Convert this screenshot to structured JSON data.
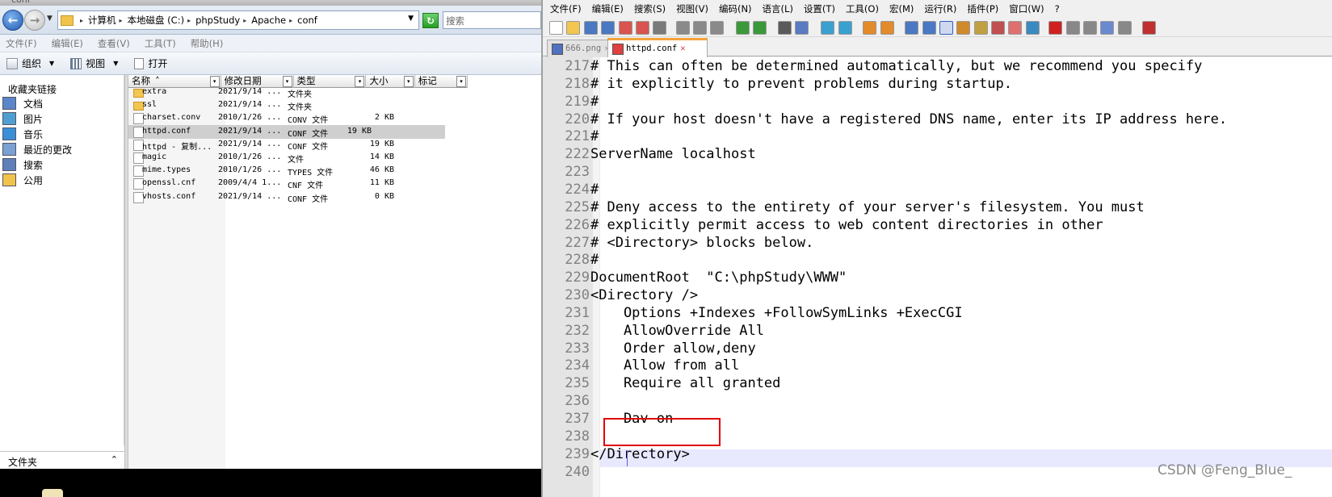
{
  "explorer": {
    "window_title": "conf",
    "address": {
      "crumbs": [
        "计算机",
        "本地磁盘 (C:)",
        "phpStudy",
        "Apache",
        "conf"
      ],
      "search_placeholder": "搜索"
    },
    "menu": [
      "文件(F)",
      "编辑(E)",
      "查看(V)",
      "工具(T)",
      "帮助(H)"
    ],
    "toolbar": {
      "organize": "组织",
      "view": "视图",
      "open": "打开"
    },
    "nav": {
      "header": "收藏夹链接",
      "items": [
        {
          "label": "文档",
          "icon": "documents-icon"
        },
        {
          "label": "图片",
          "icon": "pictures-icon"
        },
        {
          "label": "音乐",
          "icon": "music-icon"
        },
        {
          "label": "最近的更改",
          "icon": "recent-changes-icon"
        },
        {
          "label": "搜索",
          "icon": "search-icon"
        },
        {
          "label": "公用",
          "icon": "public-folder-icon"
        }
      ],
      "folders_label": "文件夹"
    },
    "columns": [
      "名称",
      "修改日期",
      "类型",
      "大小",
      "标记"
    ],
    "files": [
      {
        "name": "extra",
        "date": "2021/9/14 ...",
        "type": "文件夹",
        "size": "",
        "kind": "folder"
      },
      {
        "name": "ssl",
        "date": "2021/9/14 ...",
        "type": "文件夹",
        "size": "",
        "kind": "folder"
      },
      {
        "name": "charset.conv",
        "date": "2010/1/26 ...",
        "type": "CONV 文件",
        "size": "2 KB",
        "kind": "file"
      },
      {
        "name": "httpd.conf",
        "date": "2021/9/14 ...",
        "type": "CONF 文件",
        "size": "19 KB",
        "kind": "file",
        "selected": true
      },
      {
        "name": "httpd - 复制...",
        "date": "2021/9/14 ...",
        "type": "CONF 文件",
        "size": "19 KB",
        "kind": "file"
      },
      {
        "name": "magic",
        "date": "2010/1/26 ...",
        "type": "文件",
        "size": "14 KB",
        "kind": "file"
      },
      {
        "name": "mime.types",
        "date": "2010/1/26 ...",
        "type": "TYPES 文件",
        "size": "46 KB",
        "kind": "file"
      },
      {
        "name": "openssl.cnf",
        "date": "2009/4/4 1...",
        "type": "CNF 文件",
        "size": "11 KB",
        "kind": "file"
      },
      {
        "name": "vhosts.conf",
        "date": "2021/9/14 ...",
        "type": "CONF 文件",
        "size": "0 KB",
        "kind": "file"
      }
    ]
  },
  "npp": {
    "menu": [
      "文件(F)",
      "编辑(E)",
      "搜索(S)",
      "视图(V)",
      "编码(N)",
      "语言(L)",
      "设置(T)",
      "工具(O)",
      "宏(M)",
      "运行(R)",
      "插件(P)",
      "窗口(W)",
      "?"
    ],
    "tabs": [
      {
        "label": "666.png",
        "active": false
      },
      {
        "label": "httpd.conf",
        "active": true
      }
    ],
    "lines": [
      {
        "n": "217",
        "text": "# This can often be determined automatically, but we recommend you specify"
      },
      {
        "n": "218",
        "text": "# it explicitly to prevent problems during startup."
      },
      {
        "n": "219",
        "text": "#"
      },
      {
        "n": "220",
        "text": "# If your host doesn't have a registered DNS name, enter its IP address here."
      },
      {
        "n": "221",
        "text": "#"
      },
      {
        "n": "222",
        "text": "ServerName localhost"
      },
      {
        "n": "223",
        "text": ""
      },
      {
        "n": "224",
        "text": "#"
      },
      {
        "n": "225",
        "text": "# Deny access to the entirety of your server's filesystem. You must"
      },
      {
        "n": "226",
        "text": "# explicitly permit access to web content directories in other"
      },
      {
        "n": "227",
        "text": "# <Directory> blocks below."
      },
      {
        "n": "228",
        "text": "#"
      },
      {
        "n": "229",
        "text": "DocumentRoot  \"C:\\phpStudy\\WWW\""
      },
      {
        "n": "230",
        "text": "<Directory />"
      },
      {
        "n": "231",
        "text": "    Options +Indexes +FollowSymLinks +ExecCGI"
      },
      {
        "n": "232",
        "text": "    AllowOverride All"
      },
      {
        "n": "233",
        "text": "    Order allow,deny"
      },
      {
        "n": "234",
        "text": "    Allow from all"
      },
      {
        "n": "235",
        "text": "    Require all granted"
      },
      {
        "n": "236",
        "text": ""
      },
      {
        "n": "237",
        "text": "    Dav on"
      },
      {
        "n": "238",
        "text": ""
      },
      {
        "n": "239",
        "text": "</Directory>"
      },
      {
        "n": "240",
        "text": ""
      }
    ],
    "current_line": "238",
    "highlight_color": "#e00000"
  },
  "watermark": "CSDN @Feng_Blue_"
}
